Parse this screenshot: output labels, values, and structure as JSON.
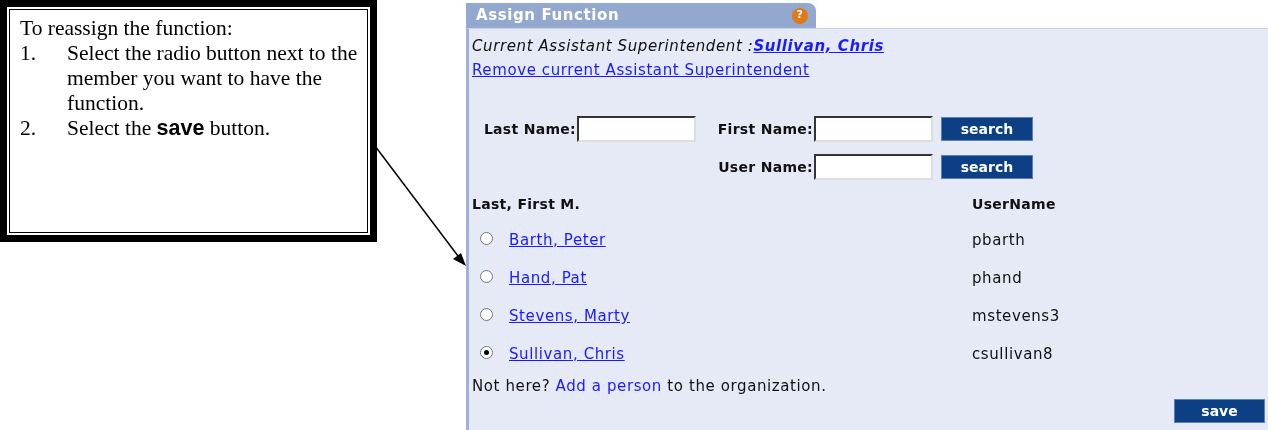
{
  "callout": {
    "heading": "To reassign the function:",
    "steps": [
      {
        "number": "1.",
        "text": "Select the radio button next to the member you want to have the function."
      },
      {
        "number": "2.",
        "text": "Select the **save** button."
      }
    ]
  },
  "panel": {
    "tab_title": "Assign Function",
    "help_icon": "?",
    "current_label": "Current Assistant Superintendent :",
    "current_name": "Sullivan, Chris",
    "remove_link": "Remove current Assistant Superintendent",
    "search": {
      "last_name_label": "Last Name:",
      "first_name_label": "First Name:",
      "user_name_label": "User Name:",
      "buttons": [
        "search",
        "search"
      ]
    },
    "columns": [
      "Last, First M.",
      "UserName"
    ],
    "members": [
      {
        "name": "Barth, Peter",
        "username": "pbarth",
        "selected": false
      },
      {
        "name": "Hand, Pat",
        "username": "phand",
        "selected": false
      },
      {
        "name": "Stevens, Marty",
        "username": "mstevens3",
        "selected": false
      },
      {
        "name": "Sullivan, Chris",
        "username": "csullivan8",
        "selected": true
      }
    ],
    "footer": {
      "before": "Not here?",
      "link": "Add a person",
      "after": "to the organization."
    },
    "save_button": "save"
  }
}
